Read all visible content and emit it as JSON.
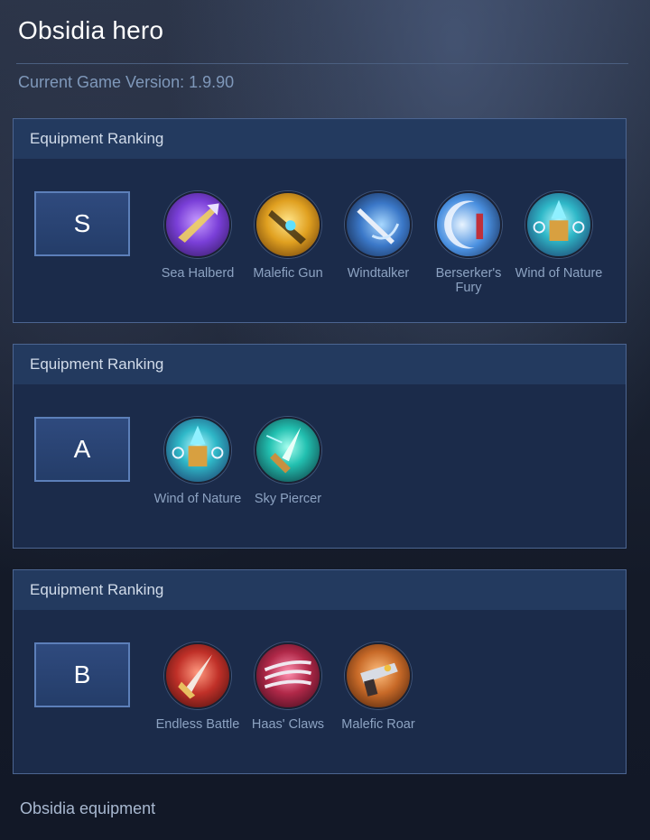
{
  "page": {
    "title": "Obsidia hero",
    "version_text": "Current Game Version: 1.9.90",
    "footer": "Obsidia equipment"
  },
  "panels": [
    {
      "header": "Equipment Ranking",
      "tier": "S",
      "items": [
        {
          "label": "Sea Halberd",
          "icon": "sea-halberd-icon",
          "color": "#7a3fd8"
        },
        {
          "label": "Malefic Gun",
          "icon": "malefic-gun-icon",
          "color": "#e0a020"
        },
        {
          "label": "Windtalker",
          "icon": "windtalker-icon",
          "color": "#3b78c8"
        },
        {
          "label": "Berserker's Fury",
          "icon": "berserkers-fury-icon",
          "color": "#4a90e0"
        },
        {
          "label": "Wind of Nature",
          "icon": "wind-of-nature-icon",
          "color": "#2fb8c8"
        }
      ]
    },
    {
      "header": "Equipment Ranking",
      "tier": "A",
      "items": [
        {
          "label": "Wind of Nature",
          "icon": "wind-of-nature-icon",
          "color": "#2fb8c8"
        },
        {
          "label": "Sky Piercer",
          "icon": "sky-piercer-icon",
          "color": "#22c0b0"
        }
      ]
    },
    {
      "header": "Equipment Ranking",
      "tier": "B",
      "items": [
        {
          "label": "Endless Battle",
          "icon": "endless-battle-icon",
          "color": "#c03028"
        },
        {
          "label": "Haas' Claws",
          "icon": "haas-claws-icon",
          "color": "#b02848"
        },
        {
          "label": "Malefic Roar",
          "icon": "malefic-roar-icon",
          "color": "#c86a28"
        }
      ]
    }
  ]
}
